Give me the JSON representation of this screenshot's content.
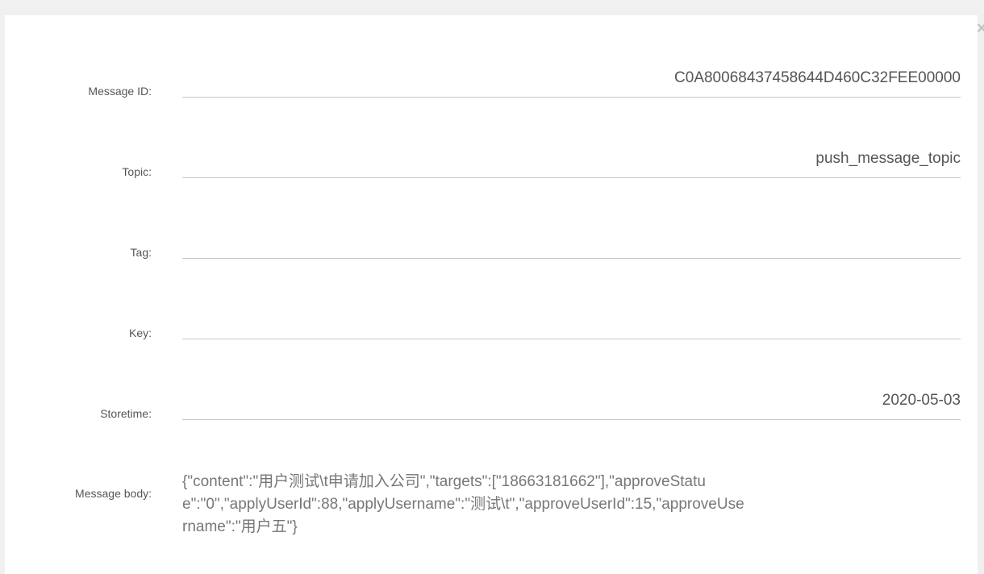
{
  "dialog": {
    "close_label": "×"
  },
  "fields": {
    "message_id": {
      "label": "Message ID:",
      "value": "C0A80068437458644D460C32FEE00000"
    },
    "topic": {
      "label": "Topic:",
      "value": "push_message_topic"
    },
    "tag": {
      "label": "Tag:",
      "value": ""
    },
    "key": {
      "label": "Key:",
      "value": ""
    },
    "storetime": {
      "label": "Storetime:",
      "value": "2020-05-03"
    },
    "message_body": {
      "label": "Message body:",
      "value": "{\"content\":\"用户测试\\t申请加入公司\",\"targets\":[\"18663181662\"],\"approveStatue\":\"0\",\"applyUserId\":88,\"applyUsername\":\"测试\\t\",\"approveUserId\":15,\"approveUsername\":\"用户五\"}"
    }
  }
}
